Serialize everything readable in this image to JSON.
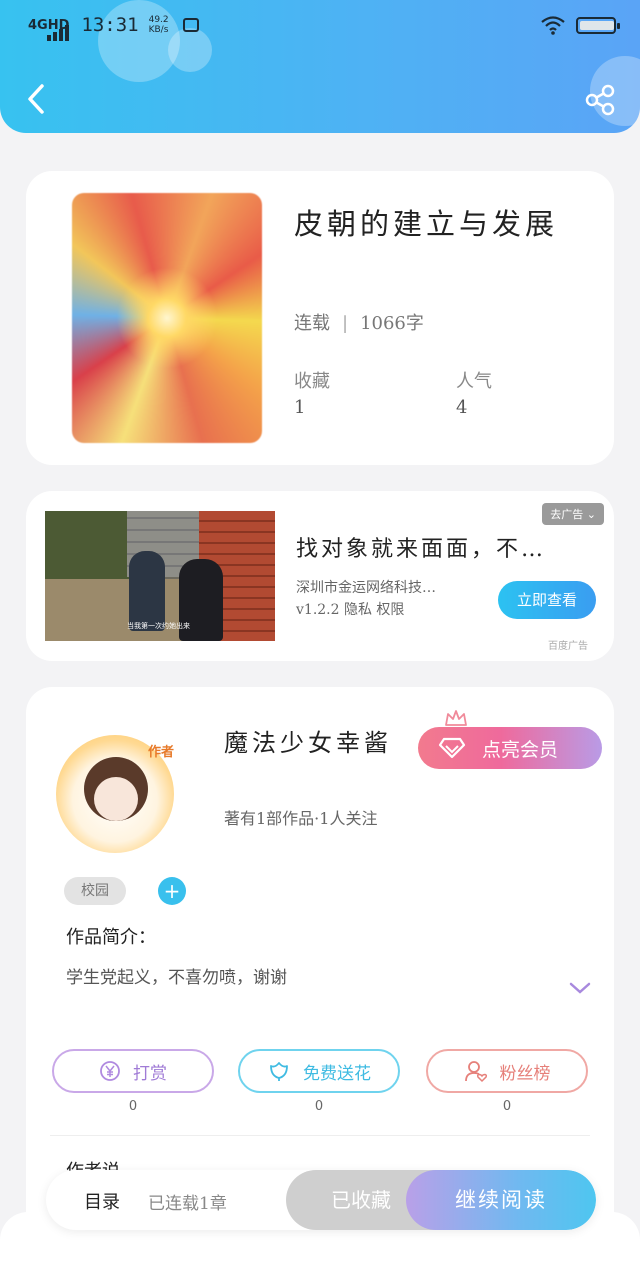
{
  "status_bar": {
    "network": "4GHD",
    "time": "13:31",
    "speed_value": "49.2",
    "speed_unit": "KB/s"
  },
  "book": {
    "title": "皮朝的建立与发展",
    "status": "连载",
    "word_count": "1066字",
    "favorites_label": "收藏",
    "favorites_value": "1",
    "popularity_label": "人气",
    "popularity_value": "4"
  },
  "ad": {
    "badge": "去广告",
    "title": "找对象就来面面，不…",
    "company": "深圳市金运网络科技…",
    "info": "v1.2.2  隐私  权限",
    "button": "立即查看",
    "source": "百度广告",
    "image_caption": "当我第一次约她出来"
  },
  "author": {
    "avatar_tag": "作者",
    "name": "魔法少女幸酱",
    "vip_button": "点亮会员",
    "works_info": "著有1部作品·1人关注",
    "tag": "校园",
    "intro_label": "作品简介：",
    "intro_text": "学生党起义，不喜勿喷，谢谢",
    "actions": [
      {
        "label": "打赏",
        "count": "0"
      },
      {
        "label": "免费送花",
        "count": "0"
      },
      {
        "label": "粉丝榜",
        "count": "0"
      }
    ],
    "author_say": "作者说"
  },
  "bottom_bar": {
    "toc": "目录",
    "chapters": "已连载1章",
    "favorited": "已收藏",
    "continue": "继续阅读"
  },
  "colors": {
    "header_start": "#37c2f0",
    "header_end": "#5aa4f6",
    "accent_blue": "#39c0ed",
    "vip_pink": "#f27a8e",
    "reward_purple": "#a07bd6",
    "flower_blue": "#3fbbe2",
    "fans_red": "#e6807a"
  }
}
